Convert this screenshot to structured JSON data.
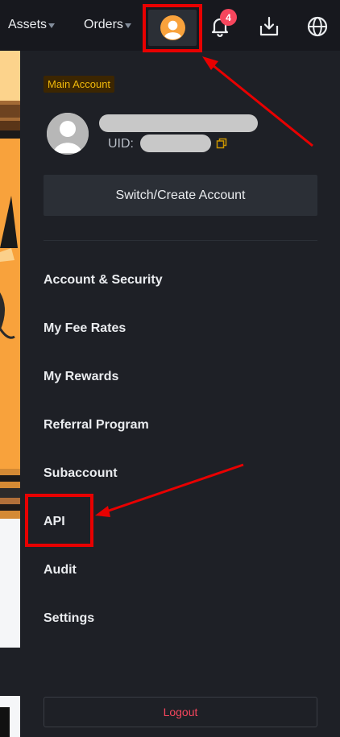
{
  "topbar": {
    "assets_label": "Assets",
    "orders_label": "Orders",
    "notification_count": "4",
    "icons": {
      "avatar": "user-avatar-icon",
      "bell": "bell-icon",
      "download": "download-icon",
      "globe": "globe-icon"
    }
  },
  "account": {
    "tag": "Main Account",
    "uid_label": "UID:",
    "switch_label": "Switch/Create Account"
  },
  "menu": {
    "items": [
      {
        "label": "Account & Security"
      },
      {
        "label": "My Fee Rates"
      },
      {
        "label": "My Rewards"
      },
      {
        "label": "Referral Program"
      },
      {
        "label": "Subaccount"
      },
      {
        "label": "API"
      },
      {
        "label": "Audit"
      },
      {
        "label": "Settings"
      }
    ]
  },
  "footer": {
    "logout_label": "Logout"
  },
  "colors": {
    "background": "#17181e",
    "panel": "#1e2026",
    "accent": "#f0b90b",
    "danger": "#f6465d",
    "annotation": "#e80000",
    "page_orange": "#f8a23c"
  }
}
